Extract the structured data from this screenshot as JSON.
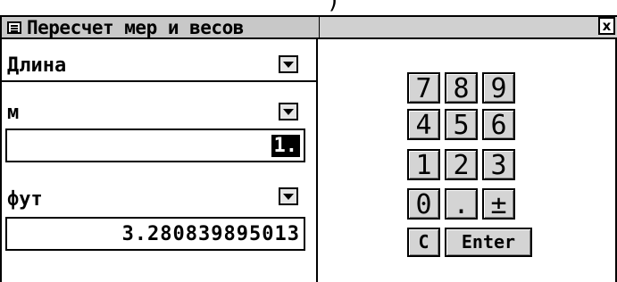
{
  "window": {
    "title": "Пересчет мер и весов",
    "close_glyph": "x",
    "top_fragment": ")"
  },
  "category": {
    "selected": "Длина"
  },
  "from_unit": {
    "selected": "м",
    "value": "1."
  },
  "to_unit": {
    "selected": "фут",
    "value": "3.280839895013"
  },
  "keypad": {
    "rows": [
      [
        "7",
        "8",
        "9"
      ],
      [
        "4",
        "5",
        "6"
      ],
      [
        "1",
        "2",
        "3"
      ],
      [
        "0",
        ".",
        "±"
      ],
      [
        "C",
        "Enter"
      ]
    ]
  },
  "icons": {
    "app": "app-window-icon",
    "close": "close-icon",
    "dropdown": "dropdown-arrow-icon"
  },
  "colors": {
    "titlebar": "#c8c8c8",
    "key_face": "#d4d4d4",
    "selection": "#000000"
  }
}
